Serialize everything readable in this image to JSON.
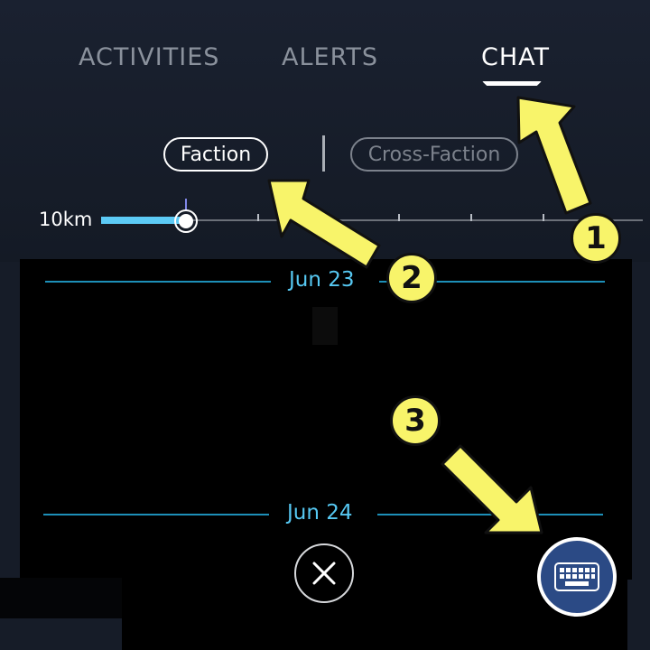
{
  "tabs": {
    "activities": "ACTIVITIES",
    "alerts": "ALERTS",
    "chat": "CHAT"
  },
  "filters": {
    "faction": "Faction",
    "cross_faction": "Cross-Faction"
  },
  "range": {
    "label": "10km",
    "selected_fraction": 0.16
  },
  "chat": {
    "dates": [
      "Jun 23",
      "Jun 24"
    ]
  },
  "annotations": [
    "1",
    "2",
    "3"
  ],
  "colors": {
    "accent": "#5ccaf5",
    "date_line": "#1d8fb8",
    "callout_yellow": "#f8f46a",
    "keyboard_button": "#2b4a85"
  },
  "icons": {
    "close": "close-icon",
    "keyboard": "keyboard-icon"
  }
}
